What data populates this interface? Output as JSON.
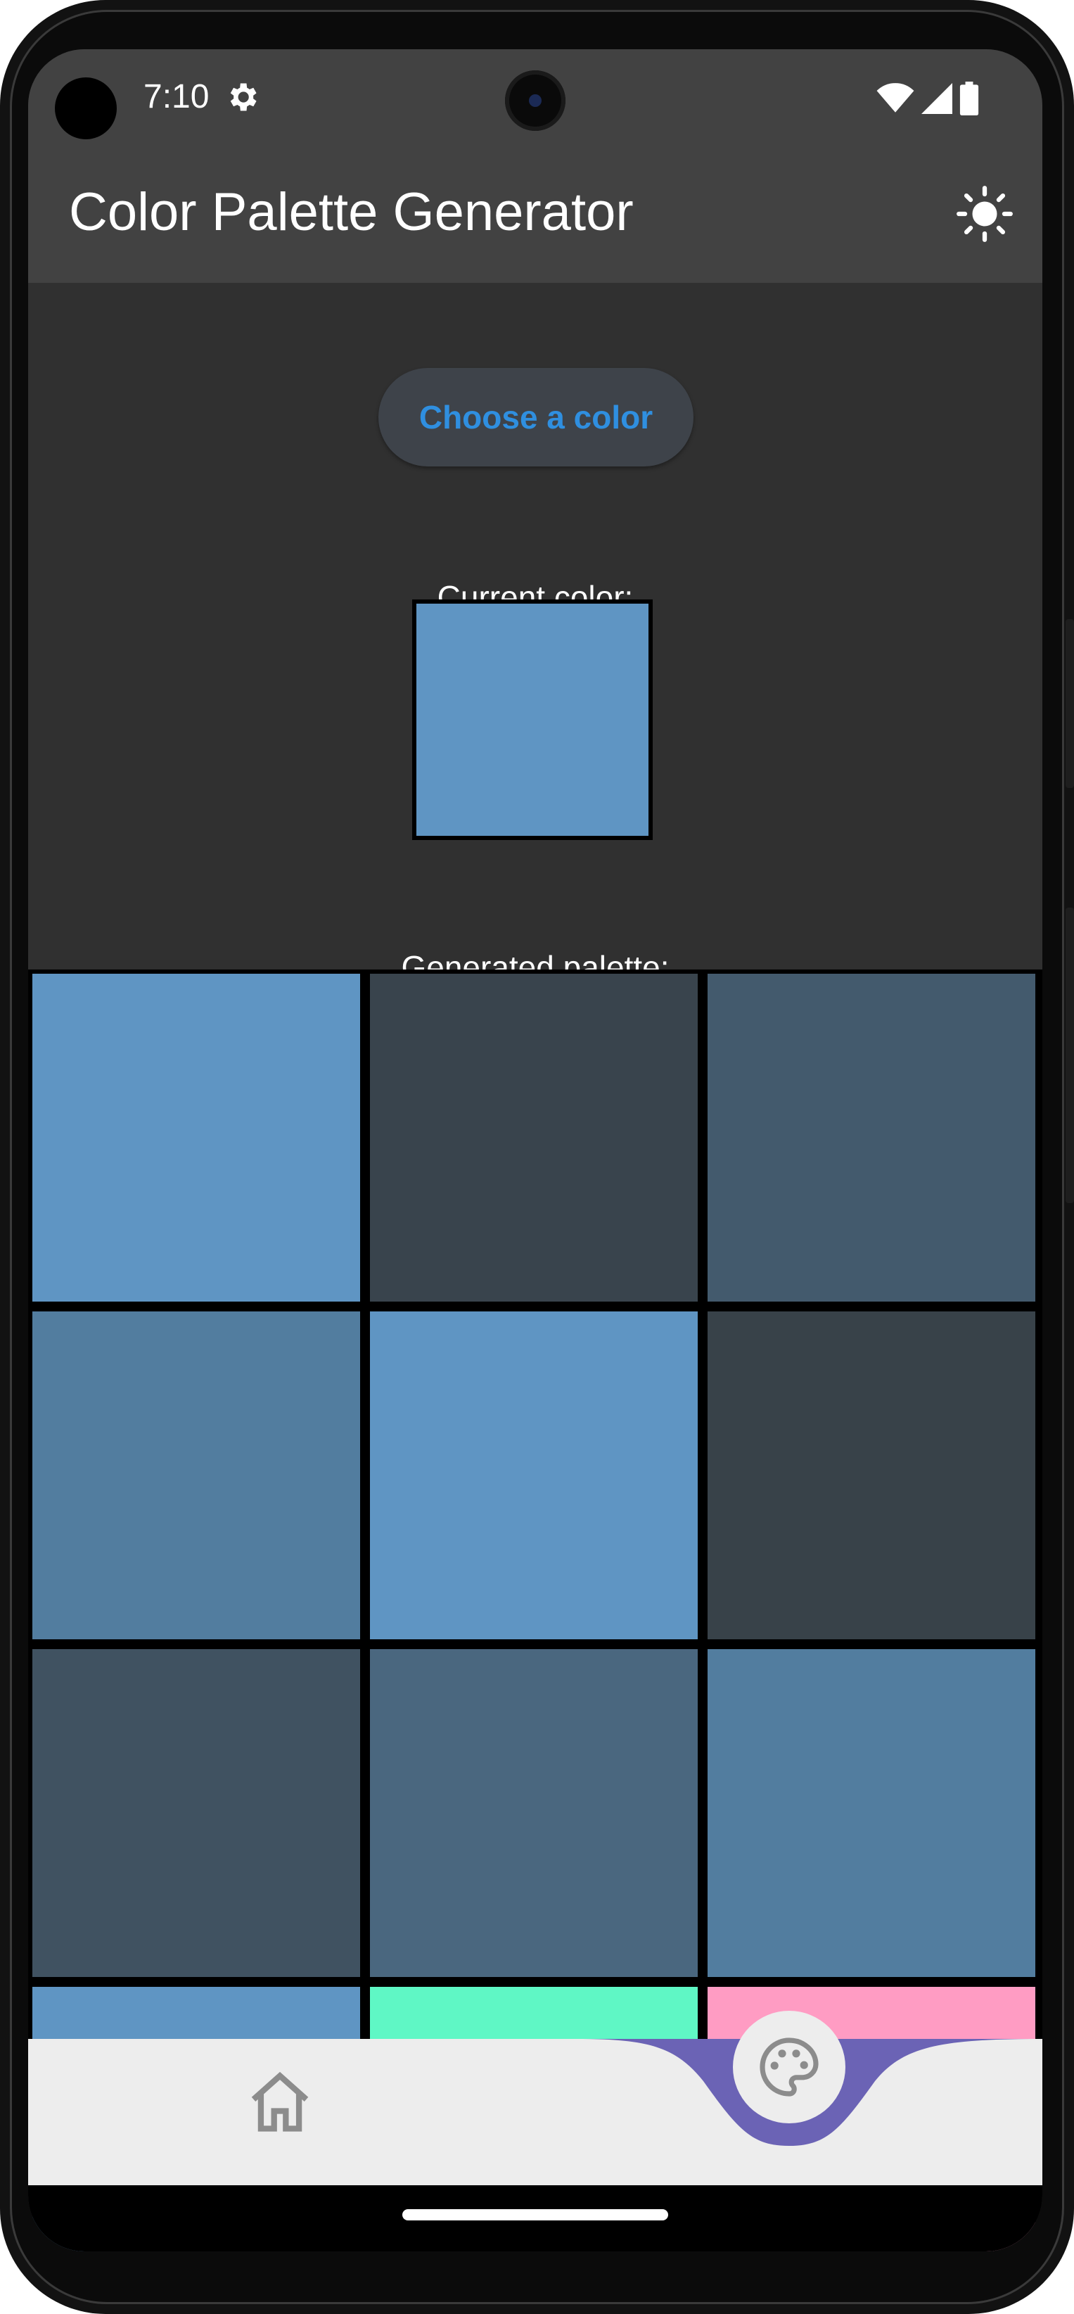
{
  "status_bar": {
    "time": "7:10",
    "icons": [
      "settings-gear-icon",
      "wifi-icon",
      "cellular-signal-icon",
      "battery-icon"
    ]
  },
  "app_bar": {
    "title": "Color Palette Generator",
    "action_icon": "brightness-sun-icon",
    "background": "#424242"
  },
  "main": {
    "choose_button_label": "Choose a color",
    "current_color_label": "Current color:",
    "current_color": "#5f95c3",
    "palette_label": "Generated palette:",
    "palette": [
      "#5f95c3",
      "#39444d",
      "#435a6d",
      "#527d9f",
      "#5f95c3",
      "#384249",
      "#405261",
      "#4a677f",
      "#527d9f",
      "#5f95c3",
      "#5ff7c5",
      "#ff9cc3"
    ]
  },
  "bottom_nav": {
    "items": [
      {
        "icon": "home-icon",
        "selected": false
      },
      {
        "icon": "palette-icon",
        "selected": true
      }
    ],
    "accent": "#6b63b5"
  },
  "colors": {
    "background": "#303030",
    "button_text": "#2f8fe0",
    "button_bg": "#3e434a"
  }
}
